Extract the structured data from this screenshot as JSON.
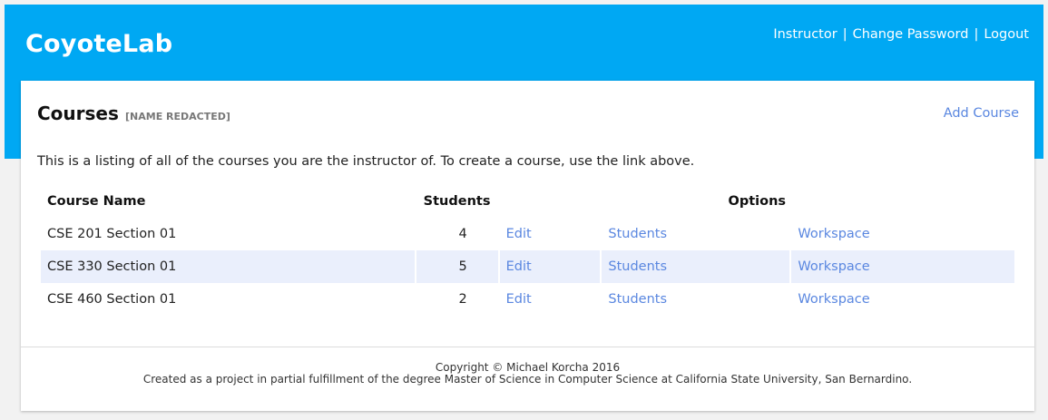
{
  "header": {
    "brand": "CoyoteLab",
    "nav": [
      "Instructor",
      "Change Password",
      "Logout"
    ],
    "separator": "|"
  },
  "main": {
    "title": "Courses",
    "subtitle": "[NAME REDACTED]",
    "add_link": "Add Course",
    "intro": "This is a listing of all of the courses you are the instructor of. To create a course, use the link above."
  },
  "table": {
    "columns": [
      "Course Name",
      "Students",
      "Options"
    ],
    "rows": [
      {
        "name": "CSE 201 Section 01",
        "students": "4",
        "actions": [
          "Edit",
          "Students",
          "Workspace"
        ]
      },
      {
        "name": "CSE 330 Section 01",
        "students": "5",
        "actions": [
          "Edit",
          "Students",
          "Workspace"
        ]
      },
      {
        "name": "CSE 460 Section 01",
        "students": "2",
        "actions": [
          "Edit",
          "Students",
          "Workspace"
        ]
      }
    ]
  },
  "footer": {
    "copyright": "Copyright © Michael Korcha 2016",
    "note": "Created as a project in partial fulfillment of the degree Master of Science in Computer Science at California State University, San Bernardino."
  },
  "colors": {
    "header_bg": "#00a8f3",
    "link": "#5a87e0",
    "row_highlight": "#eaeffc"
  }
}
